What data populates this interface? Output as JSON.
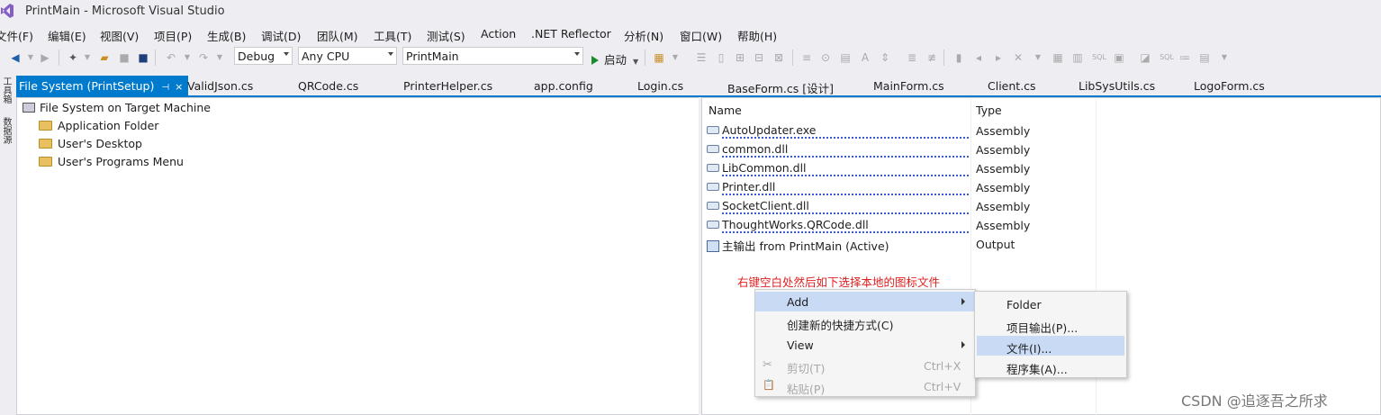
{
  "window": {
    "title": "PrintMain - Microsoft Visual Studio"
  },
  "menu": [
    "文件(F)",
    "编辑(E)",
    "视图(V)",
    "项目(P)",
    "生成(B)",
    "调试(D)",
    "团队(M)",
    "工具(T)",
    "测试(S)",
    "Action",
    ".NET Reflector",
    "分析(N)",
    "窗口(W)",
    "帮助(H)"
  ],
  "toolbar": {
    "config": "Debug",
    "platform": "Any CPU",
    "startup_project": "PrintMain",
    "start_label": "启动"
  },
  "side_strip": [
    "工具箱",
    "数据源"
  ],
  "tabs": [
    {
      "label": "File System (PrintSetup)",
      "active": true,
      "pin": "⊣",
      "close": "×"
    },
    {
      "label": "ValidJson.cs"
    },
    {
      "label": "QRCode.cs"
    },
    {
      "label": "PrinterHelper.cs"
    },
    {
      "label": "app.config"
    },
    {
      "label": "Login.cs"
    },
    {
      "label": "BaseForm.cs [设计]"
    },
    {
      "label": "MainForm.cs"
    },
    {
      "label": "Client.cs"
    },
    {
      "label": "LibSysUtils.cs"
    },
    {
      "label": "LogoForm.cs"
    }
  ],
  "tree": {
    "root": "File System on Target Machine",
    "children": [
      "Application Folder",
      "User's Desktop",
      "User's Programs Menu"
    ]
  },
  "file_list": {
    "columns": {
      "name": "Name",
      "type": "Type"
    },
    "rows": [
      {
        "name": "AutoUpdater.exe",
        "type": "Assembly"
      },
      {
        "name": "common.dll",
        "type": "Assembly"
      },
      {
        "name": "LibCommon.dll",
        "type": "Assembly"
      },
      {
        "name": "Printer.dll",
        "type": "Assembly"
      },
      {
        "name": "SocketClient.dll",
        "type": "Assembly"
      },
      {
        "name": "ThoughtWorks.QRCode.dll",
        "type": "Assembly"
      },
      {
        "name": "主输出 from PrintMain (Active)",
        "type": "Output"
      }
    ]
  },
  "annotation": "右键空白处然后如下选择本地的图标文件",
  "context_menu": [
    {
      "label": "Add",
      "submenu": true,
      "highlighted": true
    },
    {
      "label": "创建新的快捷方式(C)"
    },
    {
      "label": "View",
      "submenu": true
    },
    {
      "label": "剪切(T)",
      "shortcut": "Ctrl+X",
      "disabled": true,
      "icon": "✂"
    },
    {
      "label": "粘贴(P)",
      "shortcut": "Ctrl+V",
      "disabled": true,
      "icon": "📋"
    }
  ],
  "add_submenu": [
    {
      "label": "Folder"
    },
    {
      "label": "项目输出(P)..."
    },
    {
      "label": "文件(I)...",
      "highlighted": true
    },
    {
      "label": "程序集(A)..."
    }
  ],
  "watermark": "CSDN @追逐吾之所求",
  "colors": {
    "accent": "#007acc",
    "highlight": "#c8daf4",
    "annotation": "#e02020"
  }
}
